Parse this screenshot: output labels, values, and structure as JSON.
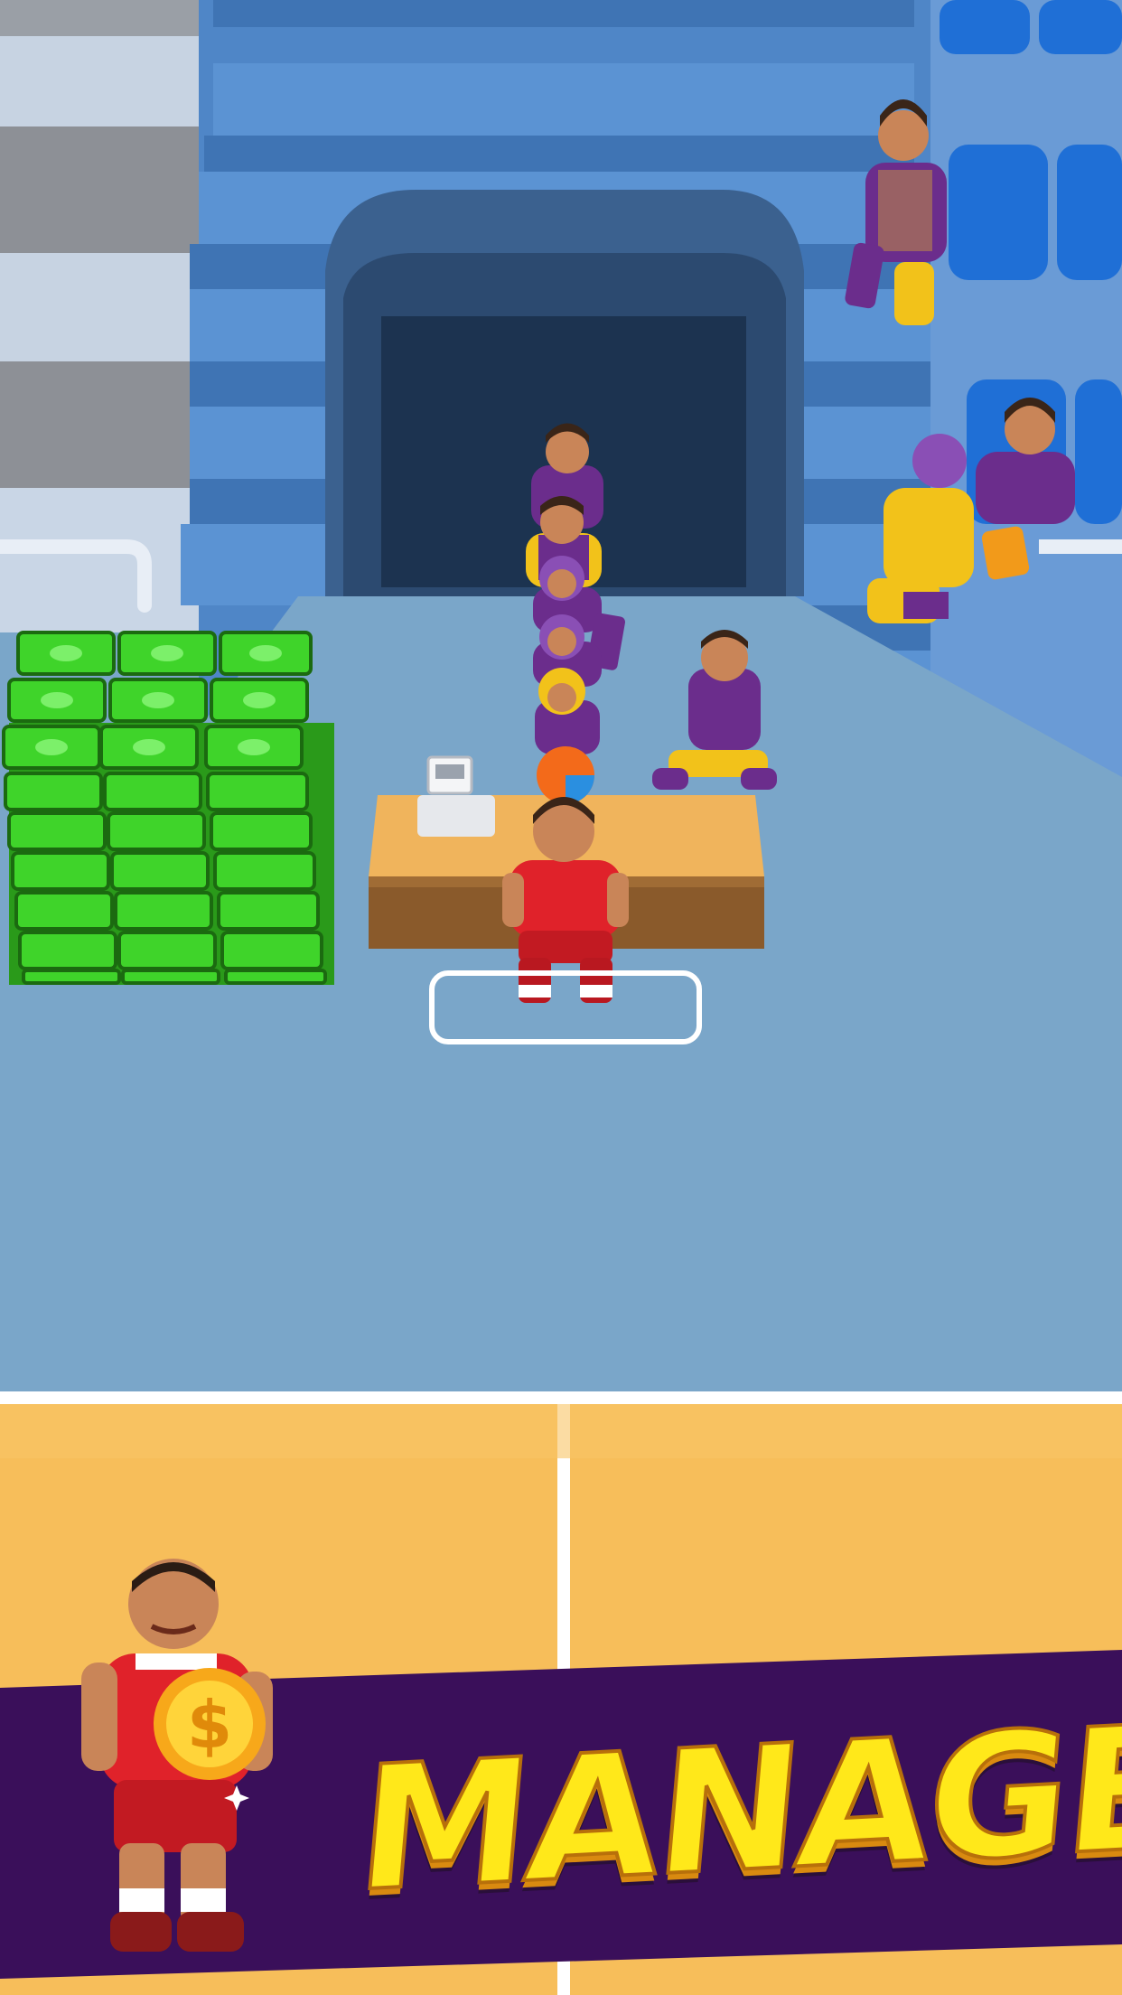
{
  "banner": {
    "text": "MANAGE"
  },
  "hud": {
    "progress_fraction": 0.25
  },
  "colors": {
    "arena_floor": "#7aa6c9",
    "bleachers": "#4f86c7",
    "seat": "#1f6fd6",
    "tunnel": "#1c3350",
    "desk_top": "#f0b45c",
    "desk_front": "#8a5a2b",
    "cash": "#3fd42a",
    "court": "#f7be5a",
    "banner_bg": "#3a0f5a",
    "banner_text": "#ffe81a",
    "team_purple": "#6b2d8c",
    "team_gold": "#f2c21a",
    "player_red": "#e0222a"
  },
  "icons": {
    "register": "cash-register-icon",
    "coin": "dollar-coin-icon",
    "progress": "pie-progress-icon"
  }
}
